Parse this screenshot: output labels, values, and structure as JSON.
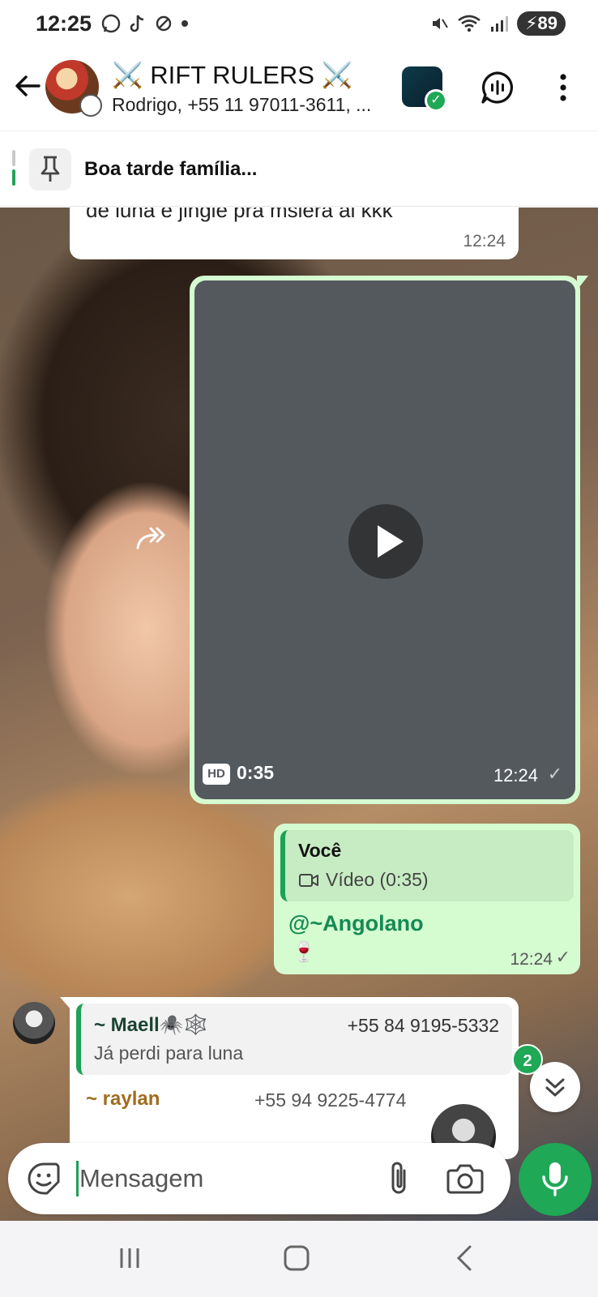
{
  "status_bar": {
    "time": "12:25",
    "battery": "89"
  },
  "header": {
    "title": "⚔️ RIFT RULERS ⚔️",
    "subtitle": "Rodrigo, +55 11 97011-3611, ..."
  },
  "pinned": {
    "text": "Boa tarde família..."
  },
  "messages": {
    "top": {
      "text": "de luna e jingle pra msiera ai kkk",
      "time": "12:24"
    },
    "video": {
      "hd": "HD",
      "duration": "0:35",
      "time": "12:24",
      "tick": "✓"
    },
    "reply_out": {
      "quote_name": "Você",
      "quote_body": "Vídeo (0:35)",
      "mention": "@~Angolano",
      "emoji": "🍷",
      "time": "12:24",
      "tick": "✓"
    },
    "incoming": {
      "quote_name": "~ Maell🕷️🕸️",
      "quote_phone": "+55 84 9195-5332",
      "quote_text": "Já perdi para luna",
      "sender_name": "~ raylan",
      "sender_phone": "+55 94 9225-4774"
    }
  },
  "unread_count": "2",
  "composer": {
    "placeholder": "Mensagem"
  },
  "colors": {
    "accent": "#1fa855",
    "outgoing_bubble": "#d5fbd1",
    "mention": "#168a54"
  }
}
